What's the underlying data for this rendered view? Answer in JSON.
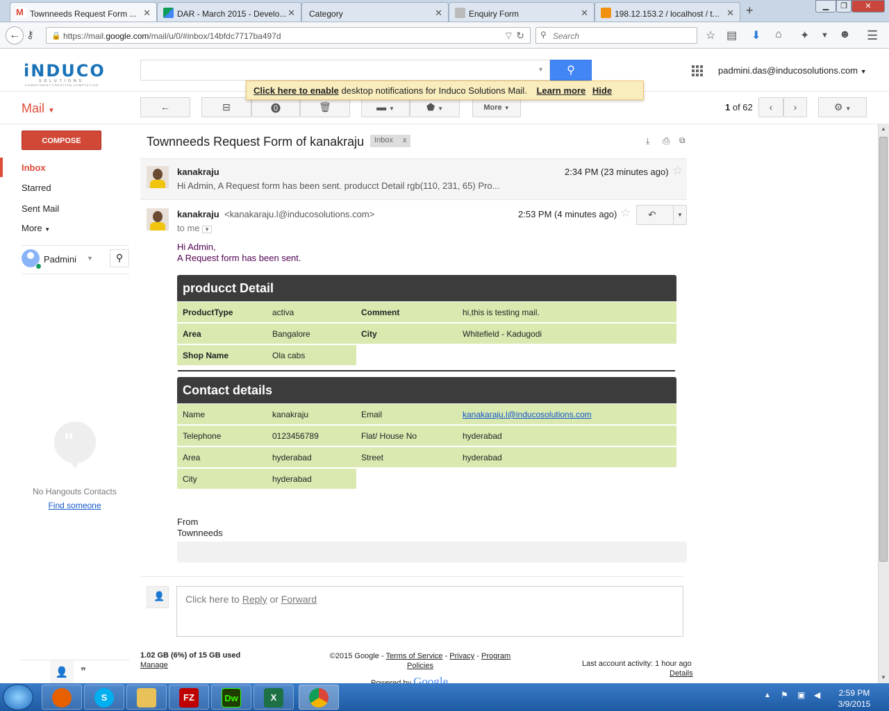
{
  "browser": {
    "tabs": [
      {
        "title": "Townneeds Request Form ...",
        "fav_color": "#db4437",
        "active": true
      },
      {
        "title": "DAR - March 2015 - Develo...",
        "fav_color": "#0f9d58"
      },
      {
        "title": "Category",
        "fav_color": "#dde6f0"
      },
      {
        "title": "Enquiry Form",
        "fav_color": "#999999"
      },
      {
        "title": "198.12.153.2 / localhost / t...",
        "fav_color": "#f29111"
      }
    ],
    "url_prefix": "https://mail.",
    "url_host": "google.com",
    "url_rest": "/mail/u/0/#inbox/14bfdc7717ba497d",
    "search_placeholder": "Search"
  },
  "gmail": {
    "logo_text": "iNDUCO",
    "logo_sub": "SOLUTIONS",
    "logo_tag": "COMMITMENT.CREATION.COMPLETION",
    "account": "padmini.das@inducosolutions.com",
    "notification": {
      "link1": "Click here to enable",
      "text": " desktop notifications for Induco Solutions Mail.",
      "learn": "Learn more",
      "hide": "Hide"
    },
    "mail_label": "Mail",
    "more_btn": "More",
    "pager_current": "1",
    "pager_rest": " of 62"
  },
  "sidebar": {
    "compose": "COMPOSE",
    "items": [
      "Inbox",
      "Starred",
      "Sent Mail",
      "More"
    ],
    "hangout_user": "Padmini",
    "no_contacts": "No Hangouts Contacts",
    "find_someone": "Find someone"
  },
  "thread": {
    "subject": "Townneeds Request Form of kanakraju",
    "label": "Inbox",
    "msg1": {
      "sender": "kanakraju",
      "time": "2:34 PM (23 minutes ago)",
      "snippet": "Hi Admin, A Request form has been sent. producct Detail rgb(110, 231, 65) Pro..."
    },
    "msg2": {
      "sender": "kanakraju",
      "email": "<kanakaraju.l@inducosolutions.com>",
      "time": "2:53 PM (4 minutes ago)",
      "to": "to me",
      "greeting": "Hi Admin,",
      "line": "A Request form has been sent."
    },
    "product": {
      "heading": "producct Detail",
      "rows": [
        {
          "k1": "ProductType",
          "v1": "activa",
          "k2": "Comment",
          "v2": "hi,this is testing mail."
        },
        {
          "k1": "Area",
          "v1": "Bangalore",
          "k2": "City",
          "v2": "Whitefield - Kadugodi"
        },
        {
          "k1": "Shop Name",
          "v1": "Ola cabs"
        }
      ]
    },
    "contact": {
      "heading": "Contact details",
      "rows": [
        {
          "k1": "Name",
          "v1": "kanakraju",
          "k2": "Email",
          "v2": "kanakaraju.l@inducosolutions.com"
        },
        {
          "k1": "Telephone",
          "v1": "0123456789",
          "k2": "Flat/ House No",
          "v2": "hyderabad"
        },
        {
          "k1": "Area",
          "v1": "hyderabad",
          "k2": "Street",
          "v2": "hyderabad"
        },
        {
          "k1": "City",
          "v1": "hyderabad"
        }
      ]
    },
    "from_label": "From",
    "from_name": "Townneeds",
    "reply_prefix": "Click here to ",
    "reply_link": "Reply",
    "reply_or": " or ",
    "forward_link": "Forward"
  },
  "footer": {
    "storage": "1.02 GB (6%) of 15 GB used",
    "manage": "Manage",
    "copyright": "©2015 Google - ",
    "terms": "Terms of Service",
    "privacy": "Privacy",
    "program": "Program Policies",
    "powered": "Powered by",
    "google": "Google",
    "activity": "Last account activity: 1 hour ago",
    "details": "Details"
  },
  "taskbar": {
    "time": "2:59 PM",
    "date": "3/9/2015",
    "apps": [
      {
        "name": "firefox",
        "label": "",
        "color": "#e66000"
      },
      {
        "name": "skype",
        "label": "S",
        "color": "#00aff0"
      },
      {
        "name": "explorer",
        "label": "",
        "color": "#e8c15a"
      },
      {
        "name": "filezilla",
        "label": "FZ",
        "color": "#bf0000"
      },
      {
        "name": "dreamweaver",
        "label": "Dw",
        "color": "#35fa00"
      },
      {
        "name": "excel",
        "label": "X",
        "color": "#1e7145"
      },
      {
        "name": "chrome",
        "label": "",
        "color": "#4285f4"
      }
    ]
  }
}
